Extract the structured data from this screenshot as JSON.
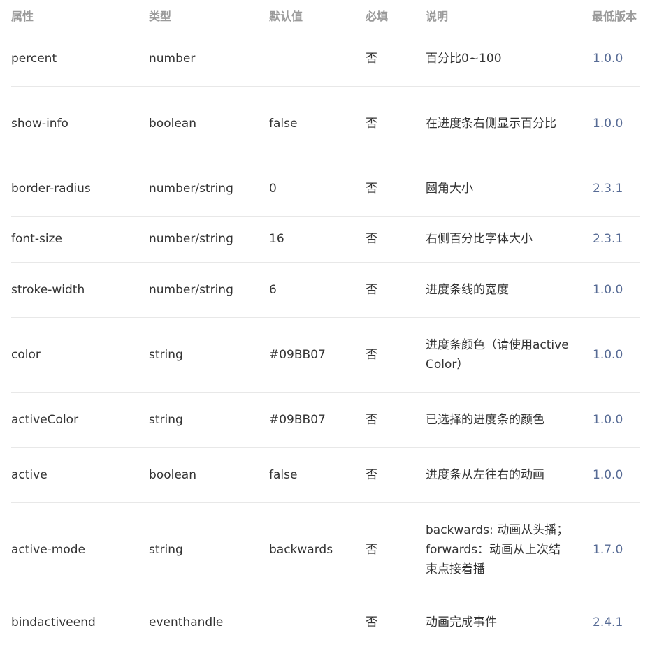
{
  "headers": {
    "attr": "属性",
    "type": "类型",
    "default": "默认值",
    "required": "必填",
    "desc": "说明",
    "version": "最低版本"
  },
  "rows": [
    {
      "attr": "percent",
      "type": "number",
      "default": "",
      "required": "否",
      "desc": "百分比0~100",
      "version": "1.0.0"
    },
    {
      "attr": "show-info",
      "type": "boolean",
      "default": "false",
      "required": "否",
      "desc": "在进度条右侧显示百分比",
      "version": "1.0.0"
    },
    {
      "attr": "border-radius",
      "type": "number/string",
      "default": "0",
      "required": "否",
      "desc": "圆角大小",
      "version": "2.3.1"
    },
    {
      "attr": "font-size",
      "type": "number/string",
      "default": "16",
      "required": "否",
      "desc": "右侧百分比字体大小",
      "version": "2.3.1"
    },
    {
      "attr": "stroke-width",
      "type": "number/string",
      "default": "6",
      "required": "否",
      "desc": "进度条线的宽度",
      "version": "1.0.0"
    },
    {
      "attr": "color",
      "type": "string",
      "default": "#09BB07",
      "required": "否",
      "desc": "进度条颜色（请使用activeColor）",
      "version": "1.0.0"
    },
    {
      "attr": "activeColor",
      "type": "string",
      "default": "#09BB07",
      "required": "否",
      "desc": "已选择的进度条的颜色",
      "version": "1.0.0"
    },
    {
      "attr": "active",
      "type": "boolean",
      "default": "false",
      "required": "否",
      "desc": "进度条从左往右的动画",
      "version": "1.0.0"
    },
    {
      "attr": "active-mode",
      "type": "string",
      "default": "backwards",
      "required": "否",
      "desc": "backwards: 动画从头播；forwards：动画从上次结束点接着播",
      "version": "1.7.0"
    },
    {
      "attr": "bindactiveend",
      "type": "eventhandle",
      "default": "",
      "required": "否",
      "desc": "动画完成事件",
      "version": "2.4.1"
    }
  ]
}
